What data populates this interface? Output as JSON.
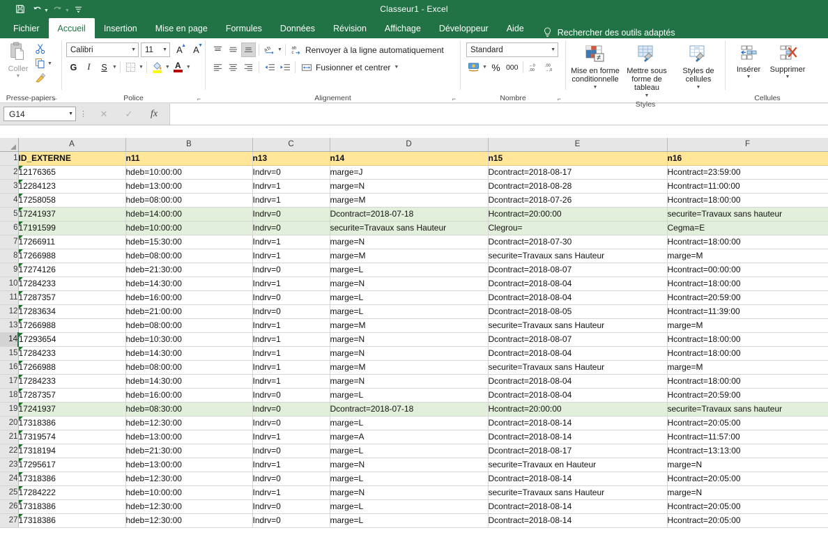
{
  "titlebar": {
    "document_title": "Classeur1  -  Excel",
    "quick_access": [
      {
        "name": "save-icon",
        "glyph": "save"
      },
      {
        "name": "undo-icon",
        "glyph": "undo"
      },
      {
        "name": "redo-icon",
        "glyph": "redo"
      },
      {
        "name": "customize-quick-access-toolbar-icon",
        "glyph": "more"
      }
    ]
  },
  "tabs": [
    {
      "label": "Fichier",
      "active": false
    },
    {
      "label": "Accueil",
      "active": true
    },
    {
      "label": "Insertion",
      "active": false
    },
    {
      "label": "Mise en page",
      "active": false
    },
    {
      "label": "Formules",
      "active": false
    },
    {
      "label": "Données",
      "active": false
    },
    {
      "label": "Révision",
      "active": false
    },
    {
      "label": "Affichage",
      "active": false
    },
    {
      "label": "Développeur",
      "active": false
    },
    {
      "label": "Aide",
      "active": false
    }
  ],
  "tell_me": {
    "label": "Rechercher des outils adaptés"
  },
  "ribbon": {
    "clipboard": {
      "group_label": "Presse-papiers",
      "paste_label": "Coller"
    },
    "font": {
      "group_label": "Police",
      "font_name": "Calibri",
      "font_size": "11",
      "bold_label": "G",
      "italic_label": "I",
      "underline_label": "S"
    },
    "alignment": {
      "group_label": "Alignement",
      "wrap_text_label": "Renvoyer à la ligne automatiquement",
      "merge_center_label": "Fusionner et centrer"
    },
    "number": {
      "group_label": "Nombre",
      "format": "Standard",
      "percent_label": "%",
      "thousands_label": "000"
    },
    "styles": {
      "group_label": "Styles",
      "conditional_formatting_label": "Mise en forme conditionnelle",
      "format_as_table_label": "Mettre sous forme de tableau",
      "cell_styles_label": "Styles de cellules"
    },
    "cells": {
      "group_label": "Cellules",
      "insert_label": "Insérer",
      "delete_label": "Supprimer"
    }
  },
  "formula_bar": {
    "name_box": "G14",
    "formula_value": ""
  },
  "sheet": {
    "column_letters": [
      "A",
      "B",
      "C",
      "D",
      "E",
      "F"
    ],
    "row_numbers": [
      1,
      2,
      3,
      4,
      5,
      6,
      7,
      8,
      9,
      10,
      11,
      12,
      13,
      14,
      15,
      16,
      17,
      18,
      19,
      20,
      21,
      22,
      23,
      24,
      25,
      26,
      27
    ],
    "active_row": 14,
    "header_fill": "#ffe699",
    "highlight_fill": "#e2efda",
    "rows": [
      {
        "n": 1,
        "style": "header",
        "cells": [
          "ID_EXTERNE",
          "n11",
          "n13",
          "n14",
          "n15",
          "n16"
        ]
      },
      {
        "n": 2,
        "style": "normal",
        "cells": [
          "12176365",
          "hdeb=10:00:00",
          "Indrv=0",
          "marge=J",
          "Dcontract=2018-08-17",
          "Hcontract=23:59:00"
        ]
      },
      {
        "n": 3,
        "style": "normal",
        "cells": [
          "12284123",
          "hdeb=13:00:00",
          "Indrv=1",
          "marge=N",
          "Dcontract=2018-08-28",
          "Hcontract=11:00:00"
        ]
      },
      {
        "n": 4,
        "style": "normal",
        "cells": [
          "17258058",
          "hdeb=08:00:00",
          "Indrv=1",
          "marge=M",
          "Dcontract=2018-07-26",
          "Hcontract=18:00:00"
        ]
      },
      {
        "n": 5,
        "style": "green",
        "cells": [
          "17241937",
          "hdeb=14:00:00",
          "Indrv=0",
          "Dcontract=2018-07-18",
          "Hcontract=20:00:00",
          "securite=Travaux sans hauteur"
        ]
      },
      {
        "n": 6,
        "style": "green",
        "cells": [
          "17191599",
          "hdeb=10:00:00",
          "Indrv=0",
          "securite=Travaux sans Hauteur",
          "Clegrou=",
          "Cegma=E"
        ]
      },
      {
        "n": 7,
        "style": "normal",
        "cells": [
          "17266911",
          "hdeb=15:30:00",
          "Indrv=1",
          "marge=N",
          "Dcontract=2018-07-30",
          "Hcontract=18:00:00"
        ]
      },
      {
        "n": 8,
        "style": "normal",
        "cells": [
          "17266988",
          "hdeb=08:00:00",
          "Indrv=1",
          "marge=M",
          "securite=Travaux sans Hauteur",
          "marge=M"
        ]
      },
      {
        "n": 9,
        "style": "normal",
        "cells": [
          "17274126",
          "hdeb=21:30:00",
          "Indrv=0",
          "marge=L",
          "Dcontract=2018-08-07",
          "Hcontract=00:00:00"
        ]
      },
      {
        "n": 10,
        "style": "normal",
        "cells": [
          "17284233",
          "hdeb=14:30:00",
          "Indrv=1",
          "marge=N",
          "Dcontract=2018-08-04",
          "Hcontract=18:00:00"
        ]
      },
      {
        "n": 11,
        "style": "normal",
        "cells": [
          "17287357",
          "hdeb=16:00:00",
          "Indrv=0",
          "marge=L",
          "Dcontract=2018-08-04",
          "Hcontract=20:59:00"
        ]
      },
      {
        "n": 12,
        "style": "normal",
        "cells": [
          "17283634",
          "hdeb=21:00:00",
          "Indrv=0",
          "marge=L",
          "Dcontract=2018-08-05",
          "Hcontract=11:39:00"
        ]
      },
      {
        "n": 13,
        "style": "normal",
        "cells": [
          "17266988",
          "hdeb=08:00:00",
          "Indrv=1",
          "marge=M",
          "securite=Travaux sans Hauteur",
          "marge=M"
        ]
      },
      {
        "n": 14,
        "style": "normal",
        "cells": [
          "17293654",
          "hdeb=10:30:00",
          "Indrv=1",
          "marge=N",
          "Dcontract=2018-08-07",
          "Hcontract=18:00:00"
        ]
      },
      {
        "n": 15,
        "style": "normal",
        "cells": [
          "17284233",
          "hdeb=14:30:00",
          "Indrv=1",
          "marge=N",
          "Dcontract=2018-08-04",
          "Hcontract=18:00:00"
        ]
      },
      {
        "n": 16,
        "style": "normal",
        "cells": [
          "17266988",
          "hdeb=08:00:00",
          "Indrv=1",
          "marge=M",
          "securite=Travaux sans Hauteur",
          "marge=M"
        ]
      },
      {
        "n": 17,
        "style": "normal",
        "cells": [
          "17284233",
          "hdeb=14:30:00",
          "Indrv=1",
          "marge=N",
          "Dcontract=2018-08-04",
          "Hcontract=18:00:00"
        ]
      },
      {
        "n": 18,
        "style": "normal",
        "cells": [
          "17287357",
          "hdeb=16:00:00",
          "Indrv=0",
          "marge=L",
          "Dcontract=2018-08-04",
          "Hcontract=20:59:00"
        ]
      },
      {
        "n": 19,
        "style": "green",
        "cells": [
          "17241937",
          "hdeb=08:30:00",
          "Indrv=0",
          "Dcontract=2018-07-18",
          "Hcontract=20:00:00",
          "securite=Travaux sans hauteur"
        ]
      },
      {
        "n": 20,
        "style": "normal",
        "cells": [
          "17318386",
          "hdeb=12:30:00",
          "Indrv=0",
          "marge=L",
          "Dcontract=2018-08-14",
          "Hcontract=20:05:00"
        ]
      },
      {
        "n": 21,
        "style": "normal",
        "cells": [
          "17319574",
          "hdeb=13:00:00",
          "Indrv=1",
          "marge=A",
          "Dcontract=2018-08-14",
          "Hcontract=11:57:00"
        ]
      },
      {
        "n": 22,
        "style": "normal",
        "cells": [
          "17318194",
          "hdeb=21:30:00",
          "Indrv=0",
          "marge=L",
          "Dcontract=2018-08-17",
          "Hcontract=13:13:00"
        ]
      },
      {
        "n": 23,
        "style": "normal",
        "cells": [
          "17295617",
          "hdeb=13:00:00",
          "Indrv=1",
          "marge=N",
          "securite=Travaux en Hauteur",
          "marge=N"
        ]
      },
      {
        "n": 24,
        "style": "normal",
        "cells": [
          "17318386",
          "hdeb=12:30:00",
          "Indrv=0",
          "marge=L",
          "Dcontract=2018-08-14",
          "Hcontract=20:05:00"
        ]
      },
      {
        "n": 25,
        "style": "normal",
        "cells": [
          "17284222",
          "hdeb=10:00:00",
          "Indrv=1",
          "marge=N",
          "securite=Travaux sans Hauteur",
          "marge=N"
        ]
      },
      {
        "n": 26,
        "style": "normal",
        "cells": [
          "17318386",
          "hdeb=12:30:00",
          "Indrv=0",
          "marge=L",
          "Dcontract=2018-08-14",
          "Hcontract=20:05:00"
        ]
      },
      {
        "n": 27,
        "style": "normal",
        "cells": [
          "17318386",
          "hdeb=12:30:00",
          "Indrv=0",
          "marge=L",
          "Dcontract=2018-08-14",
          "Hcontract=20:05:00"
        ]
      }
    ]
  }
}
